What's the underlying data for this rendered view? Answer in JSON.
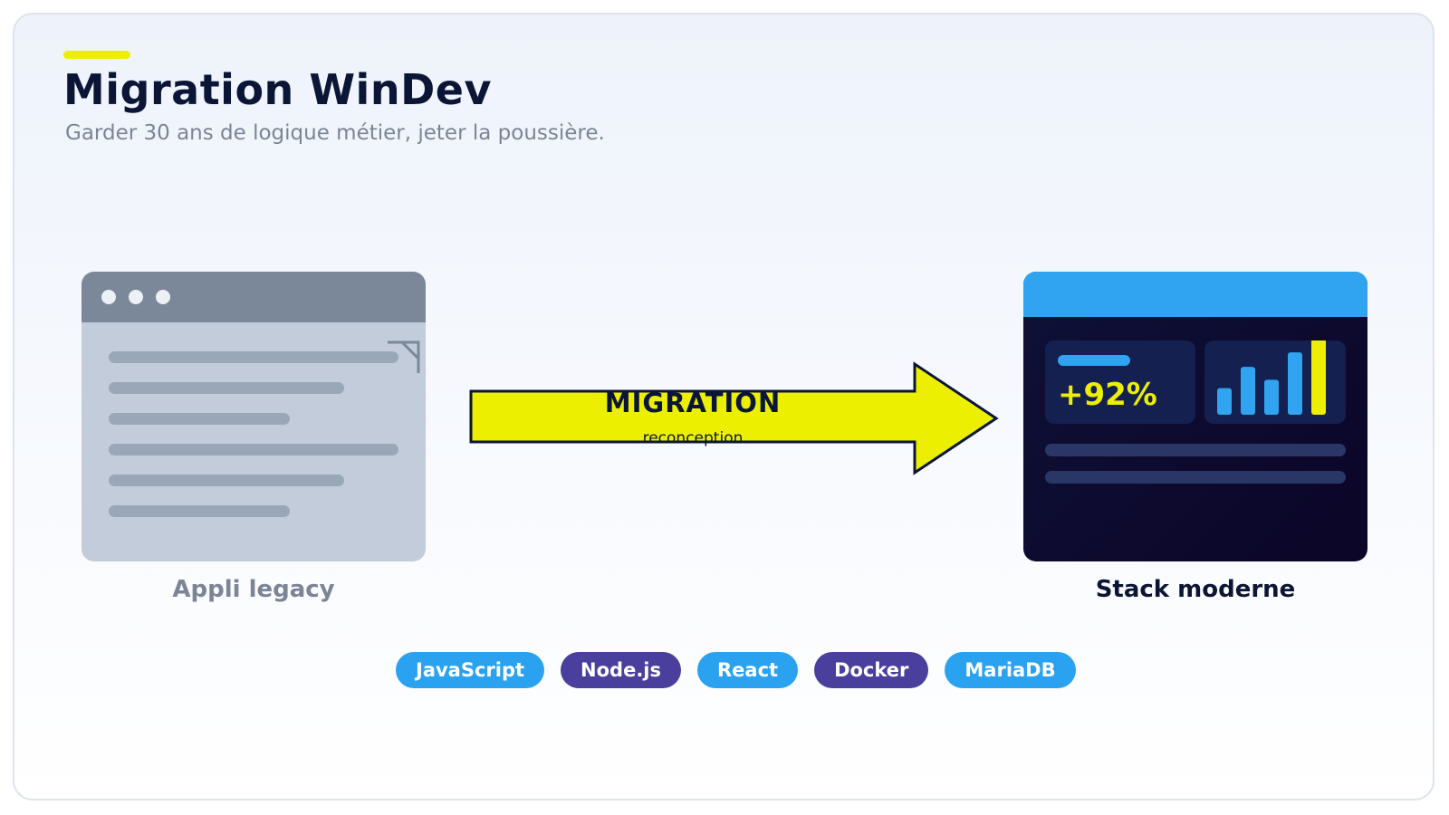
{
  "header": {
    "title": "Migration WinDev",
    "subtitle": "Garder 30 ans de logique métier, jeter la poussière."
  },
  "legacy": {
    "caption": "Appli legacy"
  },
  "arrow": {
    "label": "MIGRATION",
    "sublabel": "reconception"
  },
  "modern": {
    "caption": "Stack moderne",
    "metric": "+92%",
    "bar_levels": [
      0.35,
      0.63,
      0.46,
      0.82,
      1.0
    ]
  },
  "tech_stack": [
    {
      "label": "JavaScript",
      "color": "#2aa2f0"
    },
    {
      "label": "Node.js",
      "color": "#4a3f9c"
    },
    {
      "label": "React",
      "color": "#2aa2f0"
    },
    {
      "label": "Docker",
      "color": "#4a3f9c"
    },
    {
      "label": "MariaDB",
      "color": "#2aa2f0"
    }
  ],
  "colors": {
    "accent": "#ecf000",
    "navy": "#0b1535",
    "blue": "#30a4f0",
    "muted": "#7b8596"
  }
}
